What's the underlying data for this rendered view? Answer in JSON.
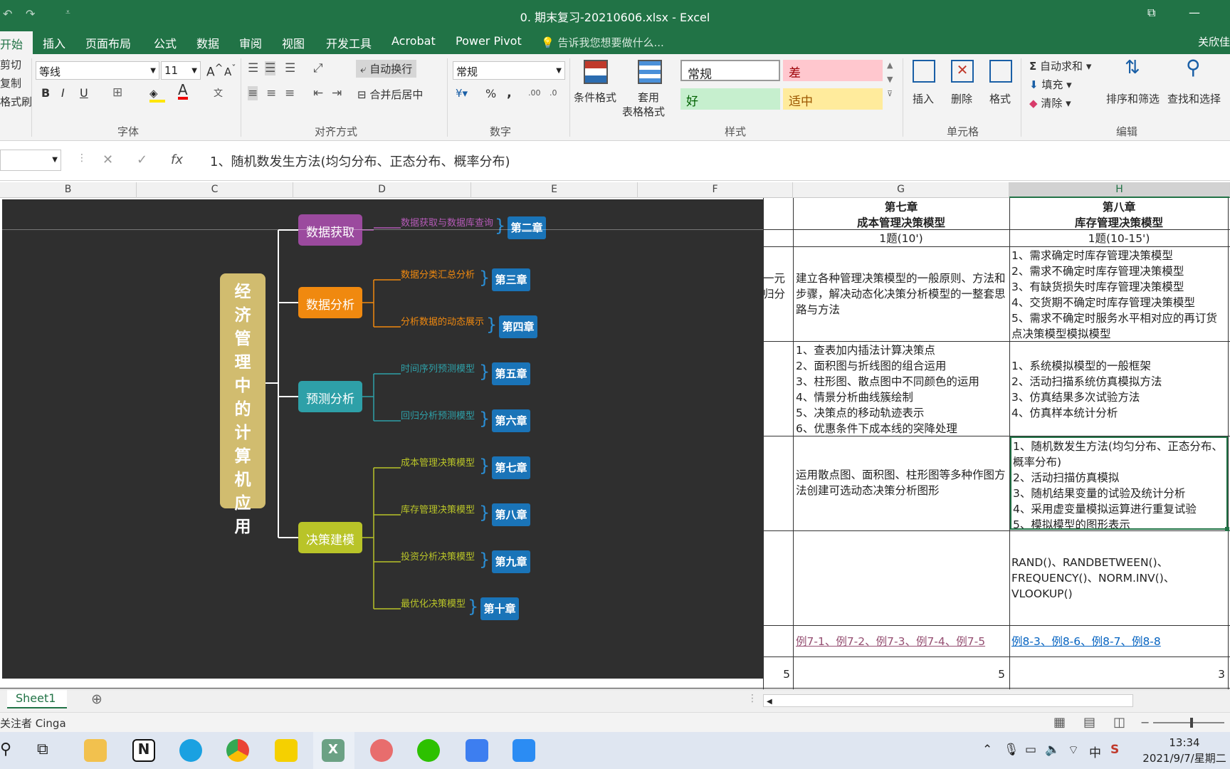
{
  "window": {
    "title": "0. 期末复习-20210606.xlsx - Excel",
    "user": "关欣佳"
  },
  "ribbon_tabs": [
    "开始",
    "插入",
    "页面布局",
    "公式",
    "数据",
    "审阅",
    "视图",
    "开发工具",
    "Acrobat",
    "Power Pivot"
  ],
  "tell_me": "告诉我您想要做什么...",
  "clipboard": {
    "cut": "剪切",
    "copy": "复制",
    "painter": "格式刷"
  },
  "font": {
    "name": "等线",
    "size": "11",
    "bold": "B",
    "italic": "I",
    "underline": "U",
    "font_color_letter": "A",
    "group_label": "字体"
  },
  "alignment": {
    "wrap_text": "自动换行",
    "merge_center": "合并后居中",
    "group_label": "对齐方式"
  },
  "number": {
    "format": "常规",
    "percent": "%",
    "comma": ",",
    "group_label": "数字"
  },
  "styles": {
    "conditional": "条件格式",
    "table_format_1": "套用",
    "table_format_2": "表格格式",
    "normal": "常规",
    "bad": "差",
    "good": "好",
    "neutral": "适中",
    "group_label": "样式"
  },
  "cells": {
    "insert": "插入",
    "delete": "删除",
    "format": "格式",
    "group_label": "单元格"
  },
  "editing": {
    "autosum": "自动求和",
    "fill": "填充",
    "clear": "清除",
    "sort_filter": "排序和筛选",
    "find_select": "查找和选择",
    "group_label": "编辑"
  },
  "formula_bar": {
    "fx": "fx",
    "content": "1、随机数发生方法(均匀分布、正态分布、概率分布)"
  },
  "columns": [
    "B",
    "C",
    "D",
    "E",
    "F",
    "G",
    "H"
  ],
  "sheet": {
    "g_header": "第七章\n成本管理决策模型",
    "h_header": "第八章\n库存管理决策模型",
    "g_count": "1题(10')",
    "h_count": "1题(10-15')",
    "f_frag_1": "一元\n归分",
    "g_row3": "建立各种管理决策模型的一般原则、方法和步骤，解决动态化决策分析模型的一整套思路与方法",
    "h_row3": "1、需求确定时库存管理决策模型\n2、需求不确定时库存管理决策模型\n3、有缺货损失时库存管理决策模型\n4、交货期不确定时库存管理决策模型\n5、需求不确定时服务水平相对应的再订货点决策模型模拟模型",
    "g_row4": "1、查表加内插法计算决策点\n2、面积图与折线图的组合运用\n3、柱形图、散点图中不同颜色的运用\n4、情景分析曲线簇绘制\n5、决策点的移动轨迹表示\n6、优惠条件下成本线的突降处理",
    "h_row4": "1、系统模拟模型的一般框架\n2、活动扫描系统仿真模拟方法\n3、仿真结果多次试验方法\n4、仿真样本统计分析",
    "g_row5": "运用散点图、面积图、柱形图等多种作图方法创建可选动态决策分析图形",
    "h_row5": "1、随机数发生方法(均匀分布、正态分布、概率分布)\n2、活动扫描仿真模拟\n3、随机结果变量的试验及统计分析\n4、采用虚变量模拟运算进行重复试验\n5、模拟模型的图形表示",
    "h_row6": "RAND()、RANDBETWEEN()、FREQUENCY()、NORM.INV()、VLOOKUP()",
    "g_row7": "例7-1、例7-2、例7-3、例7-4、例7-5",
    "h_row7": "例8-3、例8-6、例8-7、例8-8",
    "f_row8": "5",
    "g_row8": "5",
    "h_row8": "3"
  },
  "mindmap": {
    "root": "经济管理中的计算机应用",
    "branches": [
      {
        "label": "数据获取",
        "color": "#9b4a9e",
        "leaves": [
          {
            "text": "数据获取与数据库查询",
            "chapter": "第二章"
          }
        ]
      },
      {
        "label": "数据分析",
        "color": "#f0890f",
        "leaves": [
          {
            "text": "数据分类汇总分析",
            "chapter": "第三章"
          },
          {
            "text": "分析数据的动态展示",
            "chapter": "第四章"
          }
        ]
      },
      {
        "label": "预测分析",
        "color": "#2ea0a8",
        "leaves": [
          {
            "text": "时间序列预测模型",
            "chapter": "第五章"
          },
          {
            "text": "回归分析预测模型",
            "chapter": "第六章"
          }
        ]
      },
      {
        "label": "决策建模",
        "color": "#b9c428",
        "leaves": [
          {
            "text": "成本管理决策模型",
            "chapter": "第七章"
          },
          {
            "text": "库存管理决策模型",
            "chapter": "第八章"
          },
          {
            "text": "投资分析决策模型",
            "chapter": "第九章"
          },
          {
            "text": "最优化决策模型",
            "chapter": "第十章"
          }
        ]
      }
    ]
  },
  "sheet_tab": "Sheet1",
  "status": "关注者 Cinga",
  "taskbar": {
    "time": "13:34",
    "date": "2021/9/7/星期二",
    "ime": "中"
  },
  "colors": {
    "excel_green": "#217346",
    "link_purple": "#954f72",
    "link_blue": "#0563c1",
    "mindmap_bg": "#2f2f2f",
    "chapter_blue": "#1a74b8",
    "root_gold": "#d1bc6f"
  }
}
